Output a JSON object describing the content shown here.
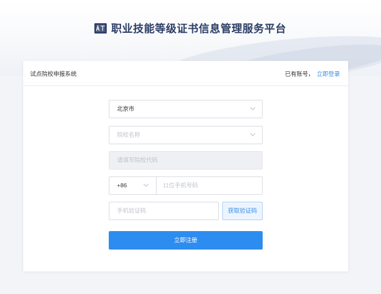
{
  "header": {
    "title": "职业技能等级证书信息管理服务平台",
    "logo_icon": "certificate-logo-icon",
    "logo_color": "#2b3d66"
  },
  "card": {
    "title": "试点院校申报系统",
    "login_prompt": "已有账号，",
    "login_link": "立即登录"
  },
  "form": {
    "region_value": "北京市",
    "school_placeholder": "院校名称",
    "school_code_placeholder": "请填写院校代码",
    "country_code": "+86",
    "phone_placeholder": "11位手机号码",
    "sms_code_placeholder": "手机验证码",
    "get_code_label": "获取验证码",
    "register_label": "立即注册"
  },
  "colors": {
    "accent": "#2d8cf0",
    "link": "#3a8ee6",
    "brand_text": "#2b3d66"
  }
}
